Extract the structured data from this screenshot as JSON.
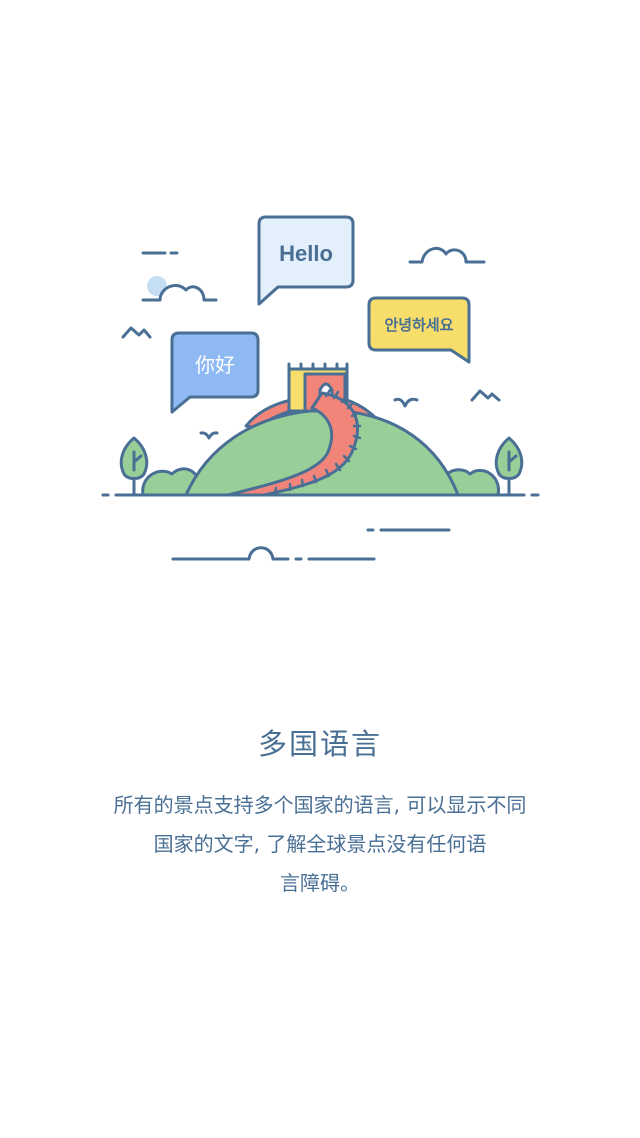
{
  "illustration": {
    "bubble_english": "Hello",
    "bubble_chinese": "你好",
    "bubble_korean": "안녕하세요"
  },
  "page": {
    "title": "多国语言",
    "description_lines": [
      "所有的景点支持多个国家的语言, 可以显示不同",
      "国家的文字, 了解全球景点没有任何语",
      "言障碍。"
    ]
  },
  "colors": {
    "stroke": "#4a6f95",
    "hill": "#98cf98",
    "wall": "#f2857a",
    "tower": "#f7dd69",
    "bubble_english_fill": "#e3f0fb",
    "bubble_chinese_fill": "#8fb9f2",
    "bubble_korean_fill": "#f7dd69",
    "sun": "#c5def4",
    "text": "#4a6f95"
  }
}
